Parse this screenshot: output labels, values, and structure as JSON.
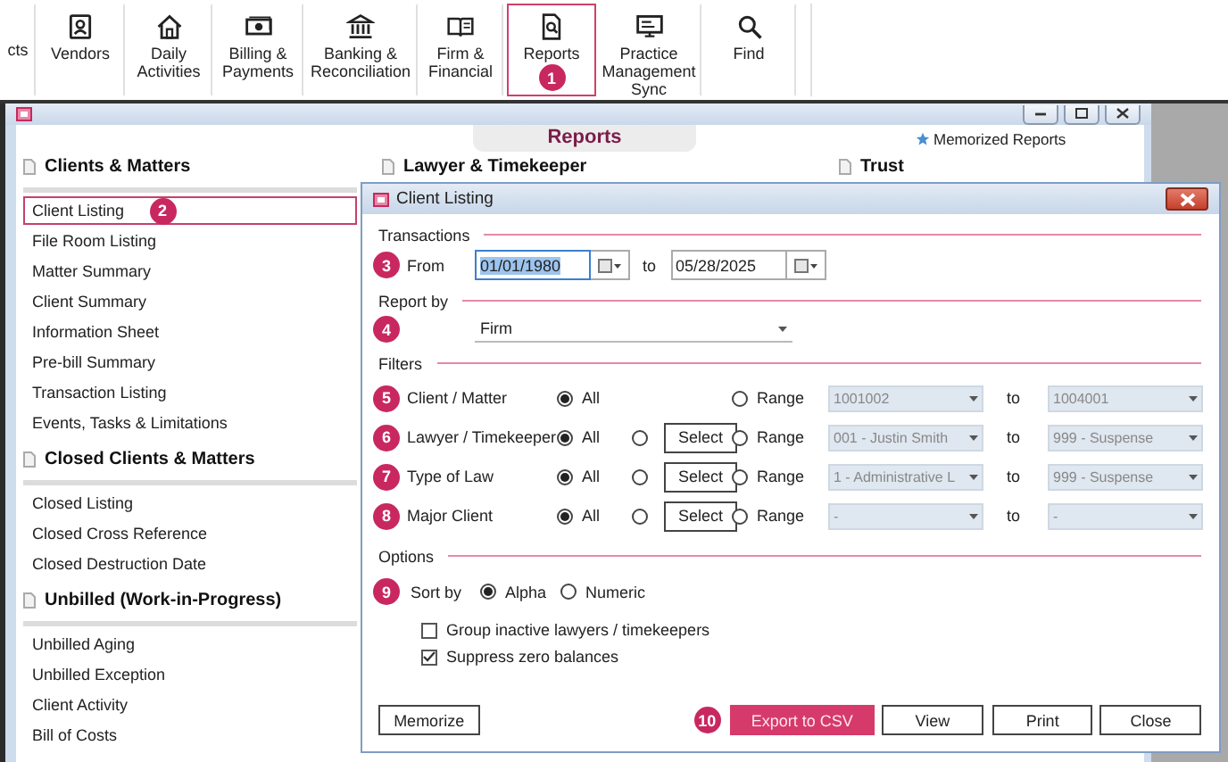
{
  "ribbon": [
    {
      "label": "cts",
      "selected": false
    },
    {
      "label": "Vendors",
      "selected": false
    },
    {
      "label": "Daily Activities",
      "selected": false
    },
    {
      "label": "Billing & Payments",
      "selected": false
    },
    {
      "label": "Banking & Reconciliation",
      "selected": false
    },
    {
      "label": "Firm & Financial",
      "selected": false
    },
    {
      "label": "Reports",
      "selected": true,
      "badge": "1"
    },
    {
      "label": "Practice Management Sync",
      "selected": false
    },
    {
      "label": "Find",
      "selected": false
    }
  ],
  "window": {
    "header": "Reports",
    "memorized": "Memorized Reports",
    "columns": [
      {
        "sections": [
          {
            "heading": "Clients & Matters",
            "items": [
              {
                "label": "Client Listing",
                "selected": true,
                "badge": "2"
              },
              {
                "label": "File Room Listing",
                "selected": false
              },
              {
                "label": "Matter Summary",
                "selected": false
              },
              {
                "label": "Client Summary",
                "selected": false
              },
              {
                "label": "Information Sheet",
                "selected": false
              },
              {
                "label": "Pre-bill Summary",
                "selected": false
              },
              {
                "label": "Transaction Listing",
                "selected": false
              },
              {
                "label": "Events, Tasks & Limitations",
                "selected": false
              }
            ]
          },
          {
            "heading": "Closed Clients & Matters",
            "items": [
              {
                "label": "Closed Listing",
                "selected": false
              },
              {
                "label": "Closed Cross Reference",
                "selected": false
              },
              {
                "label": "Closed Destruction Date",
                "selected": false
              }
            ]
          },
          {
            "heading": "Unbilled (Work-in-Progress)",
            "items": [
              {
                "label": "Unbilled Aging",
                "selected": false
              },
              {
                "label": "Unbilled Exception",
                "selected": false
              },
              {
                "label": "Client Activity",
                "selected": false
              },
              {
                "label": "Bill of Costs",
                "selected": false
              }
            ]
          }
        ]
      },
      {
        "sections": [
          {
            "heading": "Lawyer & Timekeeper"
          }
        ]
      },
      {
        "sections": [
          {
            "heading": "Trust"
          }
        ]
      }
    ]
  },
  "dialog": {
    "title": "Client Listing",
    "transactions": {
      "heading": "Transactions",
      "badge": "3",
      "from_label": "From",
      "from": {
        "value": "01/01/1980",
        "text_selected": true
      },
      "to_label": "to",
      "to": {
        "value": "05/28/2025",
        "text_selected": false
      }
    },
    "report_by": {
      "heading": "Report by",
      "badge": "4",
      "value": "Firm"
    },
    "filters": {
      "heading": "Filters",
      "rows": [
        {
          "badge": "5",
          "label": "Client / Matter",
          "options": [
            {
              "kind": "all",
              "label": "All",
              "selected": true
            },
            {
              "kind": "range",
              "label": "Range",
              "selected": false
            }
          ],
          "range_from": {
            "value": "1001002",
            "disabled": true
          },
          "to_label": "to",
          "range_to": {
            "value": "1004001",
            "disabled": true
          }
        },
        {
          "badge": "6",
          "label": "Lawyer / Timekeeper",
          "options": [
            {
              "kind": "all",
              "label": "All",
              "selected": true
            },
            {
              "kind": "select",
              "label": "Select",
              "selected": false
            },
            {
              "kind": "range",
              "label": "Range",
              "selected": false
            }
          ],
          "range_from": {
            "value": "001 - Justin Smith",
            "disabled": true
          },
          "to_label": "to",
          "range_to": {
            "value": "999 - Suspense",
            "disabled": true
          }
        },
        {
          "badge": "7",
          "label": "Type of Law",
          "options": [
            {
              "kind": "all",
              "label": "All",
              "selected": true
            },
            {
              "kind": "select",
              "label": "Select",
              "selected": false
            },
            {
              "kind": "range",
              "label": "Range",
              "selected": false
            }
          ],
          "range_from": {
            "value": "1 - Administrative L",
            "disabled": true
          },
          "to_label": "to",
          "range_to": {
            "value": "999 - Suspense",
            "disabled": true
          }
        },
        {
          "badge": "8",
          "label": "Major Client",
          "options": [
            {
              "kind": "all",
              "label": "All",
              "selected": true
            },
            {
              "kind": "select",
              "label": "Select",
              "selected": false
            },
            {
              "kind": "range",
              "label": "Range",
              "selected": false
            }
          ],
          "range_from": {
            "value": "-",
            "disabled": true
          },
          "to_label": "to",
          "range_to": {
            "value": "-",
            "disabled": true
          }
        }
      ]
    },
    "options": {
      "heading": "Options",
      "badge": "9",
      "sort_label": "Sort by",
      "sort": [
        {
          "label": "Alpha",
          "selected": true
        },
        {
          "label": "Numeric",
          "selected": false
        }
      ],
      "checks": [
        {
          "label": "Group inactive lawyers / timekeepers",
          "checked": false
        },
        {
          "label": "Suppress zero balances",
          "checked": true
        }
      ]
    },
    "buttons": [
      {
        "label": "Memorize",
        "kind": "plain"
      },
      {
        "label": "Export to CSV",
        "kind": "primary",
        "badge": "10"
      },
      {
        "label": "View",
        "kind": "plain"
      },
      {
        "label": "Print",
        "kind": "plain"
      },
      {
        "label": "Close",
        "kind": "plain"
      }
    ]
  }
}
